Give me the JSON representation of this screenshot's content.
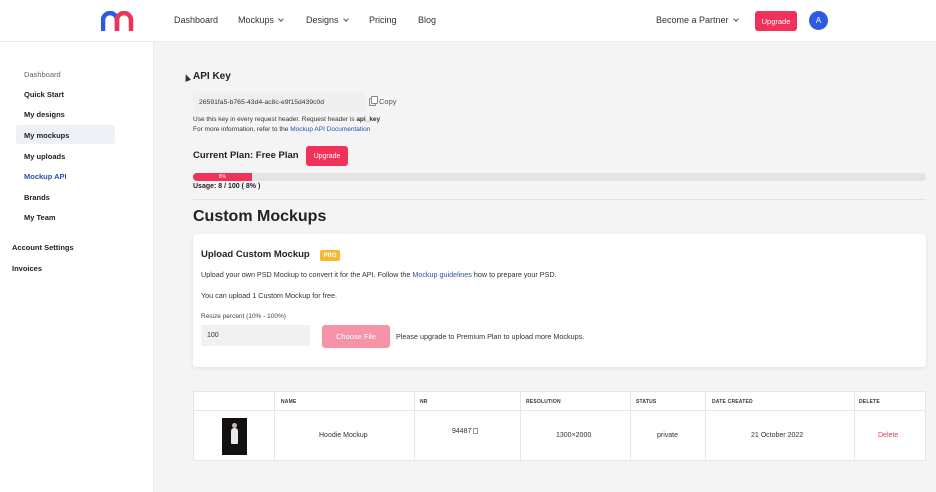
{
  "header": {
    "nav": [
      {
        "label": "Dashboard",
        "has_caret": false
      },
      {
        "label": "Mockups",
        "has_caret": true
      },
      {
        "label": "Designs",
        "has_caret": true
      },
      {
        "label": "Pricing",
        "has_caret": false
      },
      {
        "label": "Blog",
        "has_caret": false
      }
    ],
    "partner_label": "Become a Partner",
    "upgrade_label": "Upgrade",
    "avatar_initial": "A"
  },
  "sidebar": {
    "items": [
      {
        "label": "Dashboard"
      },
      {
        "label": "Quick Start"
      },
      {
        "label": "My designs"
      },
      {
        "label": "My mockups"
      },
      {
        "label": "My uploads"
      },
      {
        "label": "Mockup API"
      },
      {
        "label": "Brands"
      },
      {
        "label": "My Team"
      },
      {
        "label": "Account Settings"
      },
      {
        "label": "Invoices"
      }
    ]
  },
  "api": {
    "title": "API Key",
    "key": "26591fa5-b765-43d4-ac8c-e9f15d439c0d",
    "copy_label": "Copy",
    "hint_prefix": "Use this key in every request header. Request header is ",
    "hint_header": "api_key",
    "info_prefix": "For more information, refer to the ",
    "info_link": "Mockup API Documentation"
  },
  "plan": {
    "title": "Current Plan: Free Plan",
    "upgrade_label": "Upgrade",
    "progress_label": "8%",
    "progress_fraction": 0.08,
    "usage": "Usage: 8 / 100 ( 8% )"
  },
  "custom": {
    "title": "Custom Mockups",
    "upload_title": "Upload Custom Mockup",
    "pro_badge": "PRO",
    "desc_prefix": "Upload your own PSD Mockup to convert it for the API. Follow the ",
    "desc_link": "Mockup guidelines",
    "desc_suffix": " how to prepare your PSD.",
    "free_note": "You can upload 1 Custom Mockup for free.",
    "resize_label": "Resize percent (10% - 100%)",
    "resize_value": "100",
    "choose_file_label": "Choose File",
    "upgrade_note": "Please upgrade to Premium Plan to upload more Mockups."
  },
  "table": {
    "headers": [
      "NAME",
      "NR",
      "RESOLUTION",
      "STATUS",
      "DATE CREATED",
      "DELETE"
    ],
    "rows": [
      {
        "name": "Hoodie Mockup",
        "nr": "94487",
        "resolution": "1300×2000",
        "status": "private",
        "date": "21 October 2022",
        "delete": "Delete"
      }
    ]
  },
  "colors": {
    "accent": "#f0325a",
    "link": "#2d4fb0",
    "avatar": "#2d5be3",
    "pro": "#f5b82e"
  }
}
